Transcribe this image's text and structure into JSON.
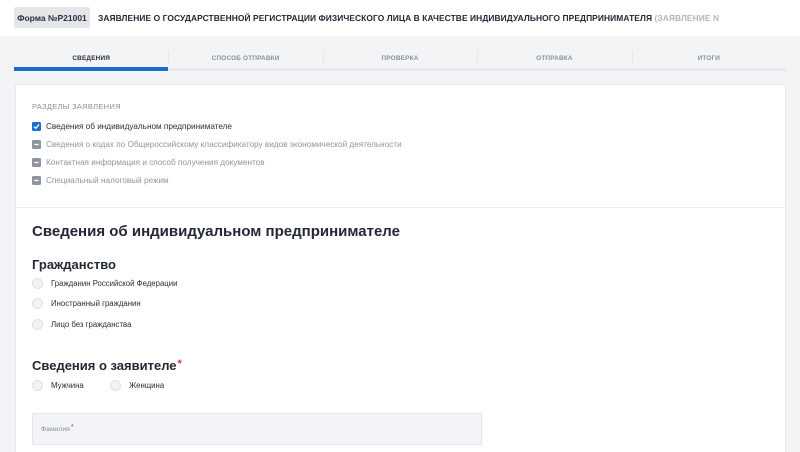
{
  "header": {
    "form_badge": "Форма №Р21001",
    "title": "ЗАЯВЛЕНИЕ О ГОСУДАРСТВЕННОЙ РЕГИСТРАЦИИ ФИЗИЧЕСКОГО ЛИЦА В КАЧЕСТВЕ ИНДИВИДУАЛЬНОГО ПРЕДПРИНИМАТЕЛЯ",
    "subtitle": "(ЗАЯВЛЕНИЕ N"
  },
  "tabs": [
    {
      "label": "СВЕДЕНИЯ",
      "active": true
    },
    {
      "label": "СПОСОБ ОТПРАВКИ",
      "active": false
    },
    {
      "label": "ПРОВЕРКА",
      "active": false
    },
    {
      "label": "ОТПРАВКА",
      "active": false
    },
    {
      "label": "ИТОГИ",
      "active": false
    }
  ],
  "sections": {
    "title": "РАЗДЕЛЫ ЗАЯВЛЕНИЯ",
    "items": [
      {
        "label": "Сведения об индивидуальном предпринимателе",
        "checked": true
      },
      {
        "label": "Сведения о кодах по Общероссийскому классификатору видов экономической деятельности",
        "checked": false
      },
      {
        "label": "Контактная информация и способ получения документов",
        "checked": false
      },
      {
        "label": "Специальный налоговый режим",
        "checked": false
      }
    ]
  },
  "main": {
    "heading": "Сведения об индивидуальном предпринимателе",
    "citizenship": {
      "heading": "Гражданство",
      "options": [
        "Гражданин Российской Федерации",
        "Иностранный гражданин",
        "Лицо без гражданства"
      ]
    },
    "applicant": {
      "heading": "Сведения о заявителе",
      "required_mark": "*",
      "gender_options": [
        "Мужчина",
        "Женщина"
      ]
    },
    "surname_field": {
      "label": "Фамилия",
      "required_mark": "*",
      "value": ""
    }
  },
  "colors": {
    "accent": "#1f6dd1",
    "required": "#e02b2b",
    "muted_text": "#8a909b",
    "background": "#f3f4f6"
  }
}
